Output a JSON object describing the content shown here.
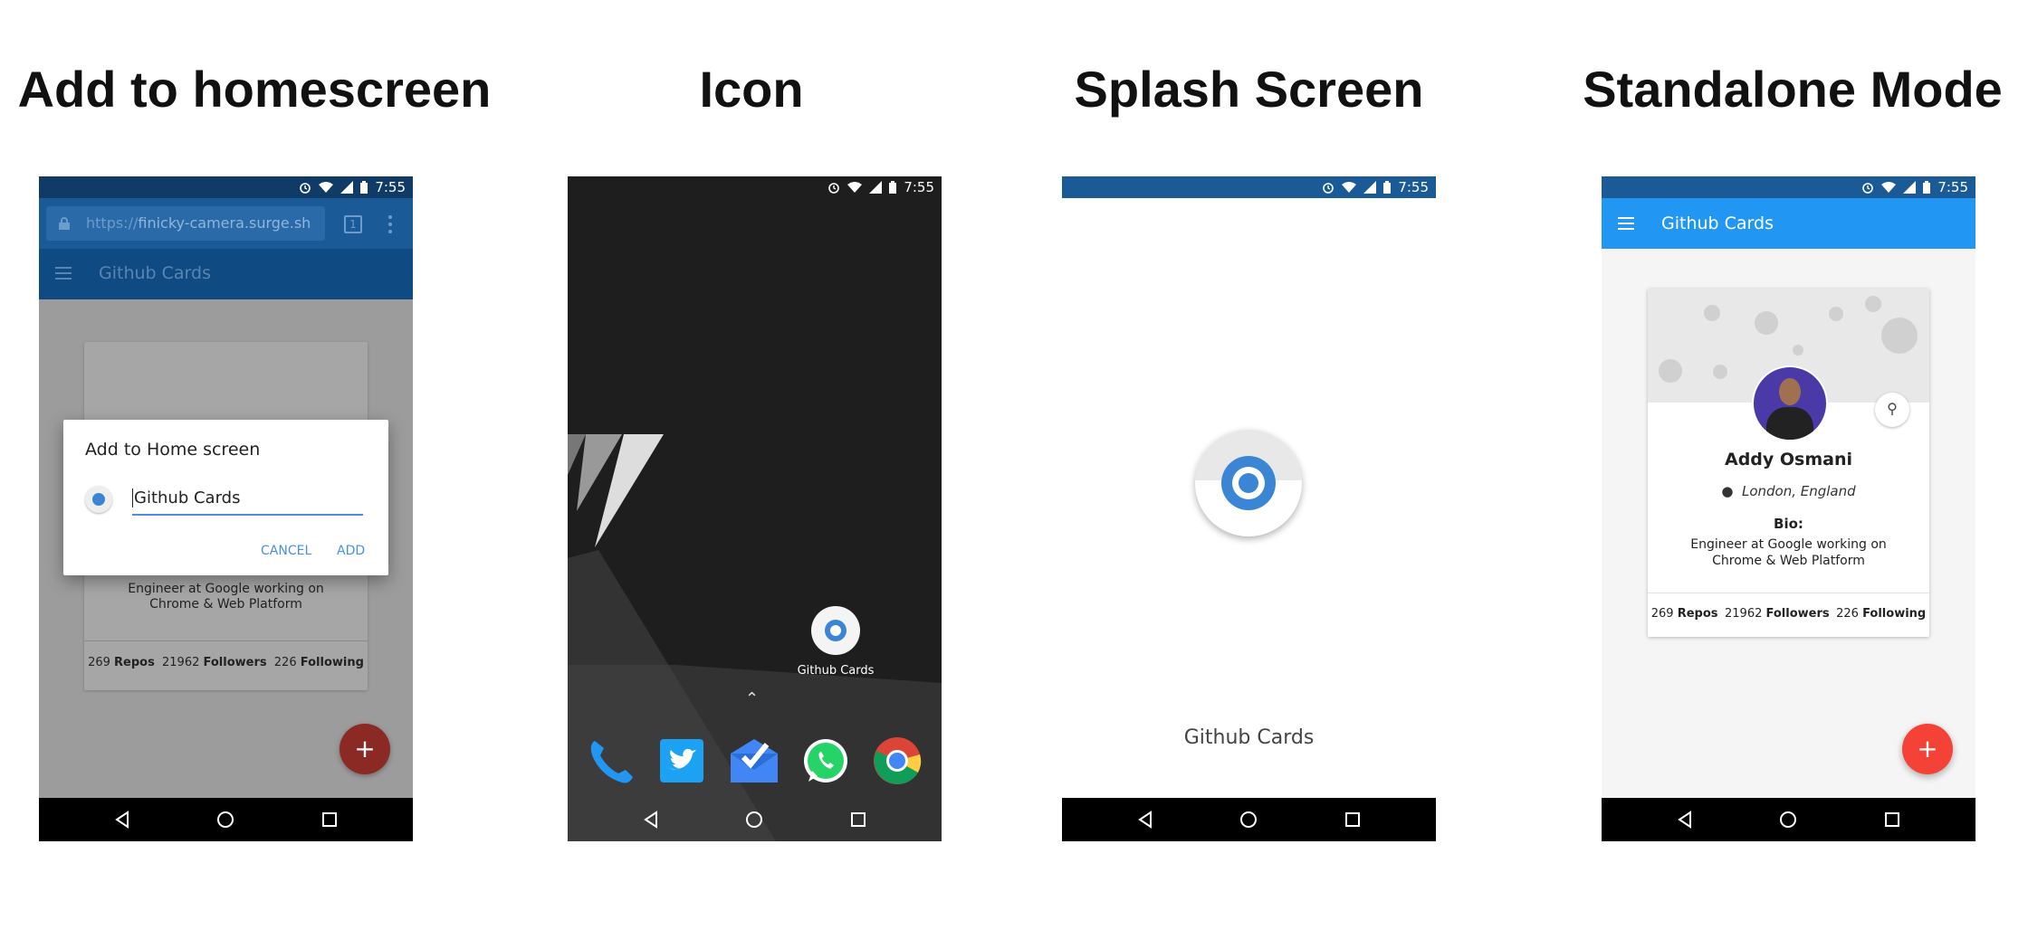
{
  "headings": [
    "Add to homescreen",
    "Icon",
    "Splash Screen",
    "Standalone Mode"
  ],
  "status_bar": {
    "time": "7:55",
    "icons": [
      "alarm-icon",
      "wifi-icon",
      "signal-icon",
      "battery-icon"
    ]
  },
  "nav_bar": {
    "icons": [
      "back-icon",
      "home-icon",
      "recents-icon"
    ]
  },
  "app": {
    "name": "Github Cards"
  },
  "browser": {
    "url_prefix": "https://",
    "url_host": "finicky-camera.surge.sh",
    "tab_count": "1"
  },
  "dialog": {
    "title": "Add to Home screen",
    "input_value": "Github Cards",
    "cancel_label": "CANCEL",
    "add_label": "ADD"
  },
  "profile": {
    "name": "Addy Osmani",
    "location": "London, England",
    "bio_label": "Bio:",
    "bio_line1": "Engineer at Google working on",
    "bio_line2": "Chrome & Web Platform",
    "repos": {
      "value": "269",
      "label": "Repos"
    },
    "followers": {
      "value": "21962",
      "label": "Followers"
    },
    "following": {
      "value": "226",
      "label": "Following"
    }
  },
  "fab_label": "+",
  "launcher": {
    "icon_label": "Github Cards",
    "app_drawer_glyph": "⌃",
    "dock": [
      "phone-icon",
      "twitter-icon",
      "inbox-icon",
      "whatsapp-icon",
      "chrome-icon"
    ]
  },
  "colors": {
    "primary": "#2196f3",
    "primary_dark": "#1a5a96",
    "accent": "#f44336",
    "chrome_dark": "#1a5a96",
    "launcher_bg": "#1e1e1e"
  }
}
